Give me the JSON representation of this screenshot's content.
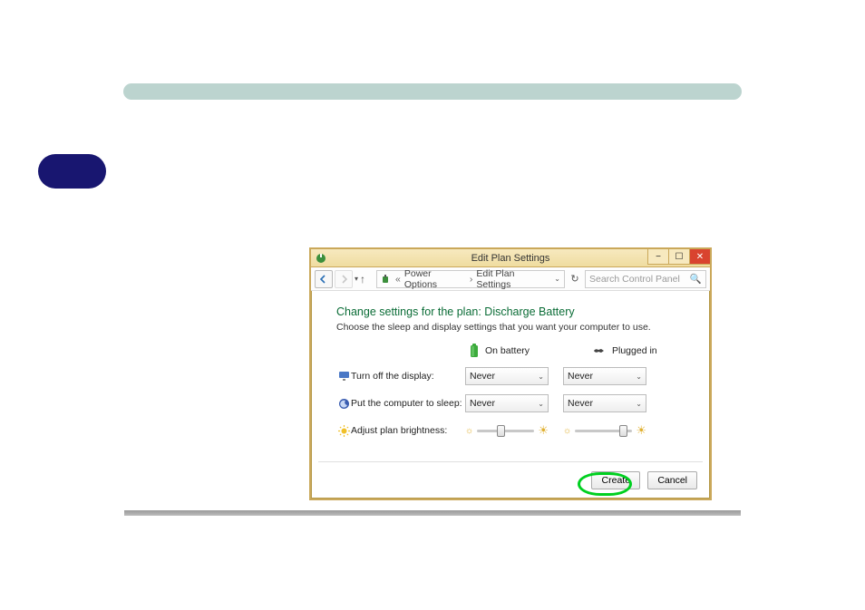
{
  "window": {
    "title": "Edit Plan Settings",
    "breadcrumb": {
      "item1": "Power Options",
      "item2": "Edit Plan Settings"
    },
    "search_placeholder": "Search Control Panel"
  },
  "content": {
    "heading": "Change settings for the plan: Discharge Battery",
    "subtext": "Choose the sleep and display settings that you want your computer to use.",
    "col_battery": "On battery",
    "col_plugged": "Plugged in",
    "rows": {
      "display_label": "Turn off the display:",
      "sleep_label": "Put the computer to sleep:",
      "brightness_label": "Adjust plan brightness:"
    },
    "values": {
      "display_battery": "Never",
      "display_plugged": "Never",
      "sleep_battery": "Never",
      "sleep_plugged": "Never"
    },
    "buttons": {
      "create": "Create",
      "cancel": "Cancel"
    }
  }
}
